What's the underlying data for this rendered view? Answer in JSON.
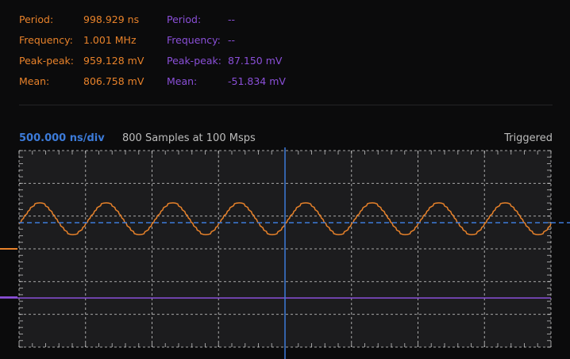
{
  "measurements": {
    "ch1": {
      "color": "#e8822a",
      "period_label": "Period:",
      "period_value": "998.929 ns",
      "frequency_label": "Frequency:",
      "frequency_value": "1.001 MHz",
      "peak_peak_label": "Peak-peak:",
      "peak_peak_value": "959.128 mV",
      "mean_label": "Mean:",
      "mean_value": "806.758 mV"
    },
    "ch2": {
      "color": "#8a4fd8",
      "period_label": "Period:",
      "period_value": "--",
      "frequency_label": "Frequency:",
      "frequency_value": "--",
      "peak_peak_label": "Peak-peak:",
      "peak_peak_value": "87.150 mV",
      "mean_label": "Mean:",
      "mean_value": "-51.834 mV"
    }
  },
  "status": {
    "timebase": "500.000 ns/div",
    "samples": "800  Samples at 100 Msps",
    "trigger_state": "Triggered"
  },
  "scope": {
    "colors": {
      "background": "#1c1c1e",
      "grid": "#d7d7d7",
      "cursor": "#3c7bd9",
      "ch1": "#e8822a",
      "ch2": "#8a4fd8"
    },
    "horizontal_divisions": 8,
    "vertical_divisions": 6,
    "ch1_cycles_visible": 8
  }
}
